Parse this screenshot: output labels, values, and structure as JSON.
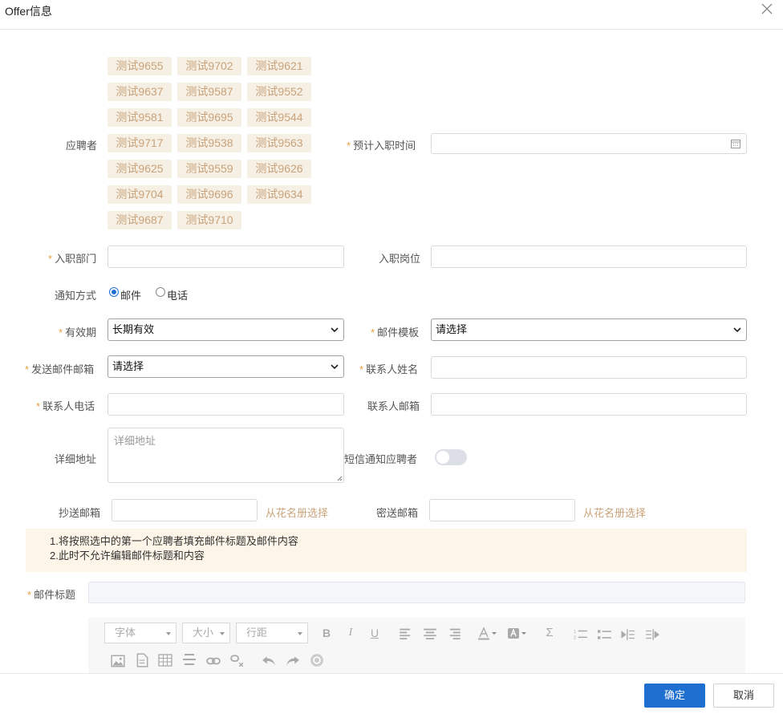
{
  "dialog": {
    "title": "Offer信息"
  },
  "applicants": {
    "label": "应聘者",
    "tags": [
      "测试9655",
      "测试9702",
      "测试9621",
      "测试9637",
      "测试9587",
      "测试9552",
      "测试9581",
      "测试9695",
      "测试9544",
      "测试9717",
      "测试9538",
      "测试9563",
      "测试9625",
      "测试9559",
      "测试9626",
      "测试9704",
      "测试9696",
      "测试9634",
      "测试9687",
      "测试9710"
    ]
  },
  "form": {
    "expected_join_time": {
      "label": "预计入职时间",
      "value": ""
    },
    "department": {
      "label": "入职部门",
      "value": ""
    },
    "position": {
      "label": "入职岗位",
      "value": ""
    },
    "notify_method": {
      "label": "通知方式",
      "options": [
        "邮件",
        "电话"
      ],
      "selected": "邮件"
    },
    "validity": {
      "label": "有效期",
      "value": "长期有效"
    },
    "mail_template": {
      "label": "邮件模板",
      "value": "请选择"
    },
    "sender_mailbox": {
      "label": "发送邮件邮箱",
      "value": "请选择"
    },
    "contact_name": {
      "label": "联系人姓名",
      "value": ""
    },
    "contact_phone": {
      "label": "联系人电话",
      "value": ""
    },
    "contact_email": {
      "label": "联系人邮箱",
      "value": ""
    },
    "address": {
      "label": "详细地址",
      "placeholder": "详细地址"
    },
    "sms_notify": {
      "label": "短信通知应聘者",
      "enabled": false
    },
    "cc": {
      "label": "抄送邮箱",
      "value": "",
      "link": "从花名册选择"
    },
    "bcc": {
      "label": "密送邮箱",
      "value": "",
      "link": "从花名册选择"
    },
    "mail_subject": {
      "label": "邮件标题",
      "value": ""
    }
  },
  "notice": {
    "lines": [
      "1.将按照选中的第一个应聘者填充邮件标题及邮件内容",
      "2.此时不允许编辑邮件标题和内容"
    ]
  },
  "editor_toolbar": {
    "font_label": "字体",
    "size_label": "大小",
    "line_height_label": "行距"
  },
  "footer": {
    "confirm_label": "确定",
    "cancel_label": "取消"
  },
  "colors": {
    "primary": "#1f6fd1",
    "tag_bg": "#f6efe4",
    "tag_text": "#c9a37a",
    "required": "#e6a23c",
    "notice_bg": "#fdf6e8"
  }
}
